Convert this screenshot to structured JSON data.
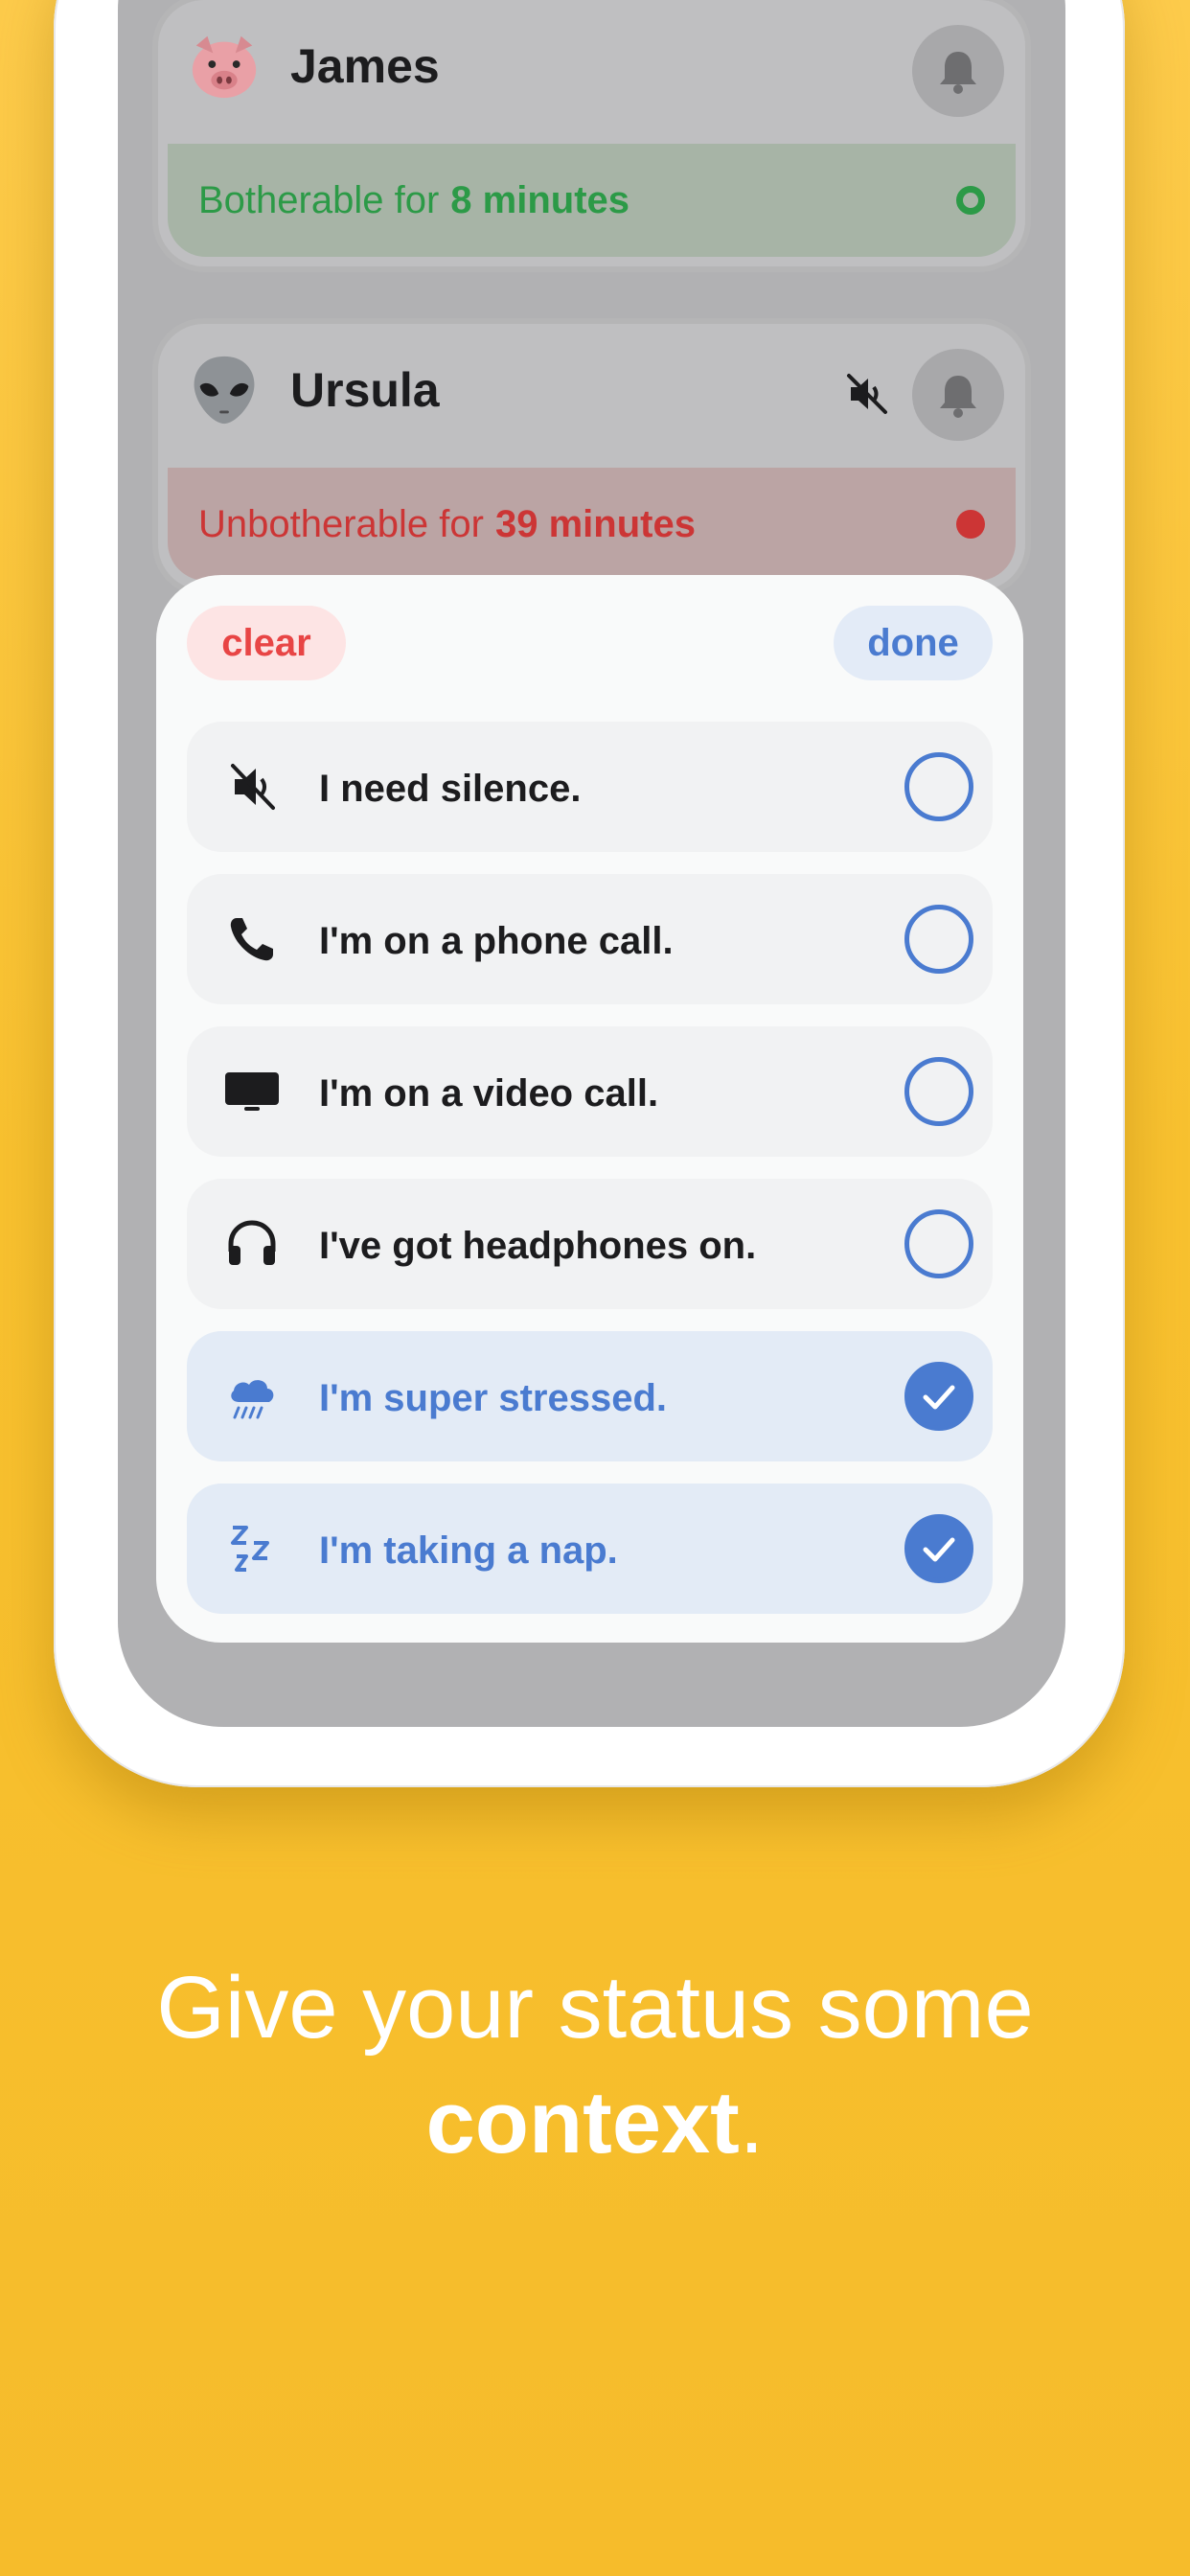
{
  "people": [
    {
      "emoji": "pig-face-emoji",
      "name": "James",
      "status_prefix": "Botherable for",
      "status_duration": "8 minutes",
      "status": "green",
      "muted": false
    },
    {
      "emoji": "alien-emoji",
      "name": "Ursula",
      "status_prefix": "Unbotherable for",
      "status_duration": "39 minutes",
      "status": "red",
      "muted": true
    }
  ],
  "sheet": {
    "clear_label": "clear",
    "done_label": "done",
    "options": [
      {
        "icon": "speaker-muted-icon",
        "label": "I need silence.",
        "selected": false
      },
      {
        "icon": "phone-icon",
        "label": "I'm on a phone call.",
        "selected": false
      },
      {
        "icon": "tv-icon",
        "label": "I'm on a video call.",
        "selected": false
      },
      {
        "icon": "headphones-icon",
        "label": "I've got headphones on.",
        "selected": false
      },
      {
        "icon": "cloud-rain-icon",
        "label": "I'm super stressed.",
        "selected": true
      },
      {
        "icon": "zzz-icon",
        "label": "I'm taking a nap.",
        "selected": true
      }
    ]
  },
  "caption": {
    "line1": "Give your status some",
    "line2_bold": "context",
    "line2_rest": "."
  },
  "colors": {
    "background": "#F8C12F",
    "accent_blue": "#4A7BD0",
    "clear_red": "#E84545",
    "green": "#2C9A47",
    "red": "#CC3535"
  }
}
